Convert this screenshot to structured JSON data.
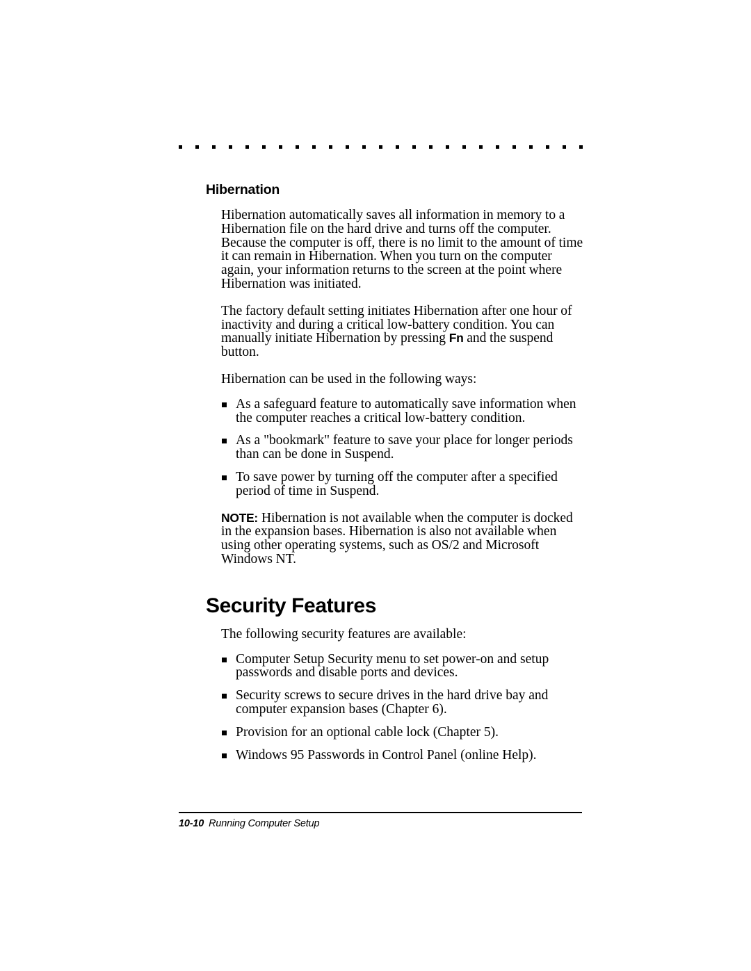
{
  "page": {
    "paper": "#ffffff",
    "ink": "#000000",
    "decor": {
      "dot_rule_name": "dotted-rule",
      "dot_count": 25
    }
  },
  "sections": [
    {
      "heading": "Hibernation",
      "heading_level": "sub",
      "paragraphs": [
        "Hibernation automatically saves all information in memory to a Hibernation file on the hard drive and turns off the computer. Because the computer is off, there is no limit to the amount of time it can remain in Hibernation. When you turn on the computer again, your information returns to the screen at the point where Hibernation was initiated.",
        "The factory default setting initiates Hibernation after one hour of inactivity and during a critical low-battery condition. You can manually initiate Hibernation by pressing ",
        "Hibernation can be used in the following ways:"
      ],
      "keycap": "Fn",
      "paragraph_2_tail": " and the suspend button.",
      "bullets": [
        "As a safeguard feature to automatically save information when the computer reaches a critical low-battery condition.",
        "As a \"bookmark\" feature to save your place for longer periods than can be done in Suspend.",
        "To save power by turning off the computer after a specified period of time in Suspend."
      ],
      "note": {
        "label": "NOTE:",
        "text": "Hibernation is not available when the computer is docked in the expansion bases. Hibernation is also not available when using other operating systems, such as OS/2 and Microsoft Windows NT."
      }
    },
    {
      "heading": "Security Features",
      "heading_level": "main",
      "intro": "The following security features are available:",
      "bullets": [
        "Computer Setup Security menu to set power-on and setup passwords and disable ports and devices.",
        "Security screws to secure drives in the hard drive bay and computer expansion bases (Chapter 6).",
        "Provision for an optional cable lock (Chapter 5).",
        "Windows 95 Passwords in Control Panel (online Help)."
      ]
    }
  ],
  "footer": {
    "page_number": "10-10",
    "running_title": "Running Computer Setup"
  }
}
